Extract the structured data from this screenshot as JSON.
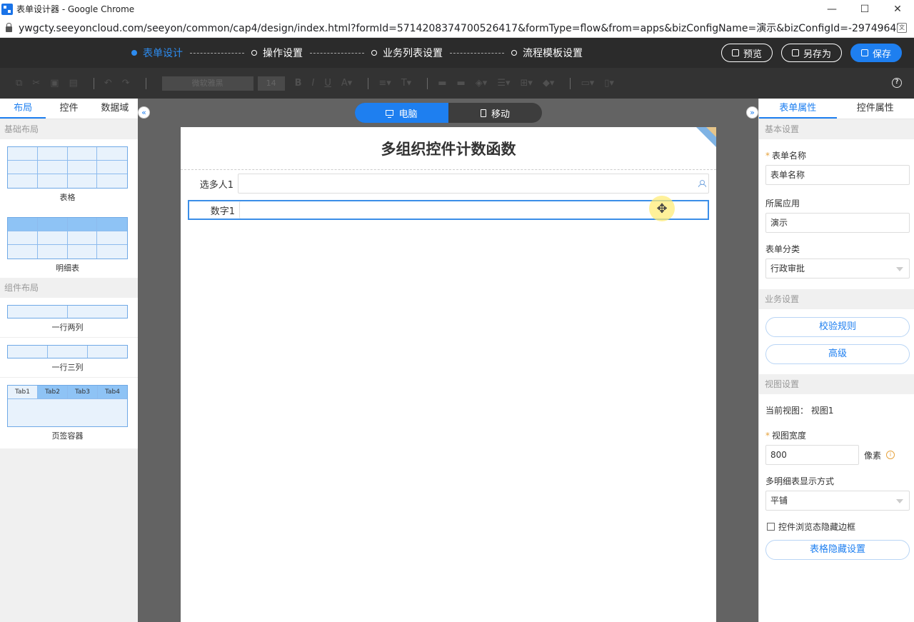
{
  "window": {
    "title": "表单设计器 - Google Chrome",
    "url": "ywgcty.seeyoncloud.com/seeyon/common/cap4/design/index.html?formId=5714208374700526417&formType=flow&from=apps&bizConfigName=演示&bizConfigId=-297496473577696190..."
  },
  "header": {
    "steps": [
      {
        "label": "表单设计",
        "active": true
      },
      {
        "label": "操作设置",
        "active": false
      },
      {
        "label": "业务列表设置",
        "active": false
      },
      {
        "label": "流程模板设置",
        "active": false
      }
    ],
    "buttons": {
      "preview": "预览",
      "save_as": "另存为",
      "save": "保存"
    }
  },
  "toolbar": {
    "font": "微软雅黑",
    "size": "14"
  },
  "left_panel": {
    "tabs": [
      "布局",
      "控件",
      "数据域"
    ],
    "section_basic": "基础布局",
    "table_label": "表格",
    "detail_label": "明细表",
    "section_component": "组件布局",
    "two_col_label": "一行两列",
    "three_col_label": "一行三列",
    "tab_container_label": "页签容器",
    "tab_names": [
      "Tab1",
      "Tab2",
      "Tab3",
      "Tab4"
    ]
  },
  "canvas": {
    "device_pc": "电脑",
    "device_mobile": "移动",
    "form_title": "多组织控件计数函数",
    "fields": [
      {
        "label": "选多人1"
      },
      {
        "label": "数字1"
      }
    ]
  },
  "right_panel": {
    "tabs": [
      "表单属性",
      "控件属性"
    ],
    "section_basic": "基本设置",
    "form_name_label": "表单名称",
    "form_name_value": "表单名称",
    "app_label": "所属应用",
    "app_value": "演示",
    "category_label": "表单分类",
    "category_value": "行政审批",
    "section_business": "业务设置",
    "validate_btn": "校验规则",
    "advanced_btn": "高级",
    "section_view": "视图设置",
    "current_view_label": "当前视图：",
    "current_view_value": "视图1",
    "view_width_label": "视图宽度",
    "view_width_value": "800",
    "unit": "像素",
    "multi_detail_label": "多明细表显示方式",
    "multi_detail_value": "平铺",
    "hide_border_label": "控件浏览态隐藏边框",
    "table_hide_btn": "表格隐藏设置"
  },
  "colors": {
    "accent": "#1e7ff0",
    "header_bg": "#2b2b2b",
    "canvas_bg": "#636363"
  }
}
